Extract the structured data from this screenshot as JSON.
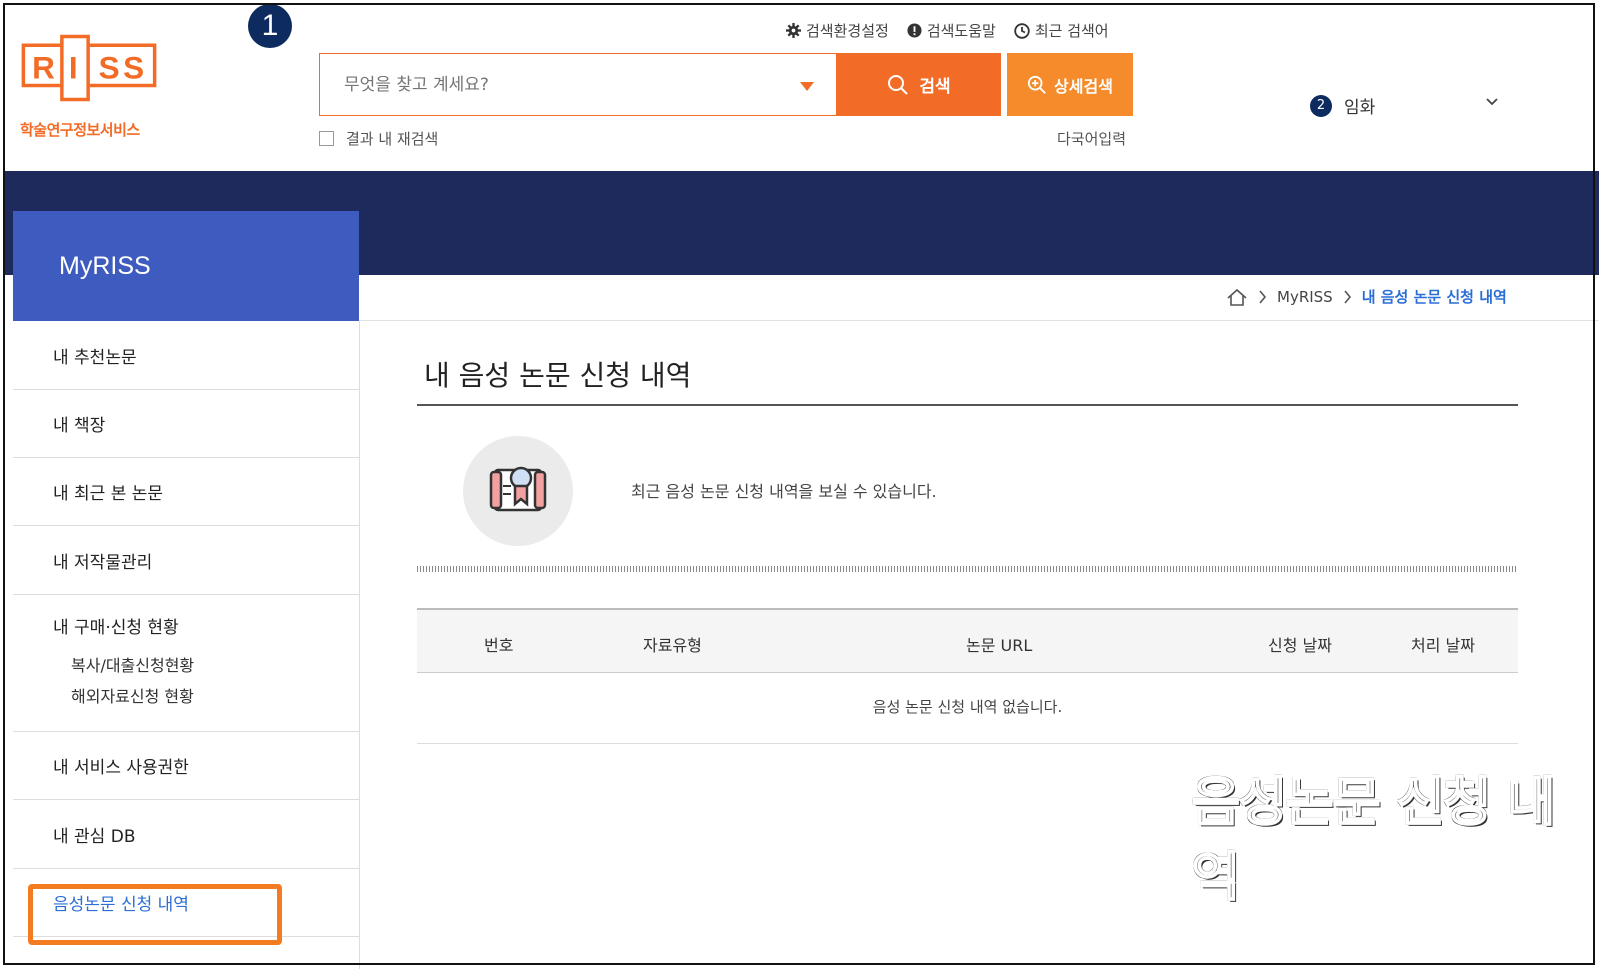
{
  "step_number": "1",
  "logo": {
    "letters": [
      "R",
      "I",
      "S",
      "S"
    ],
    "subtitle": "학술연구정보서비스"
  },
  "header": {
    "util_links": [
      {
        "icon": "gear-icon",
        "label": "검색환경설정"
      },
      {
        "icon": "info-icon",
        "label": "검색도움말"
      },
      {
        "icon": "clock-icon",
        "label": "최근 검색어"
      }
    ],
    "search_placeholder": "무엇을 찾고 계세요?",
    "search_button": "검색",
    "advanced_button": "상세검색",
    "research_in_results": "결과 내 재검색",
    "multilang": "다국어입력",
    "user_badge": "2",
    "user_name": "임화"
  },
  "sidebar": {
    "title": "MyRISS",
    "items": [
      {
        "label": "내 추천논문"
      },
      {
        "label": "내 책장"
      },
      {
        "label": "내 최근 본 논문"
      },
      {
        "label": "내 저작물관리"
      },
      {
        "label": "내 구매·신청 현황",
        "subs": [
          "복사/대출신청현황",
          "해외자료신청 현황"
        ]
      },
      {
        "label": "내 서비스 사용권한"
      },
      {
        "label": "내 관심 DB"
      },
      {
        "label": "음성논문 신청 내역",
        "active": true
      }
    ]
  },
  "breadcrumb": {
    "section": "MyRISS",
    "current": "내 음성 논문 신청 내역"
  },
  "main": {
    "title": "내 음성 논문 신청 내역",
    "info": "최근 음성 논문 신청 내역을 보실 수 있습니다.",
    "columns": [
      "번호",
      "자료유형",
      "논문 URL",
      "신청 날짜",
      "처리 날짜"
    ],
    "empty": "음성 논문 신청 내역 없습니다."
  },
  "caption": "음성논문 신청 내역",
  "colors": {
    "brand_orange": "#f26c27",
    "navy": "#1e2a5c",
    "sidebar_blue": "#3e5bbf",
    "link_blue": "#2b6fd6",
    "highlight": "#f47c20"
  }
}
